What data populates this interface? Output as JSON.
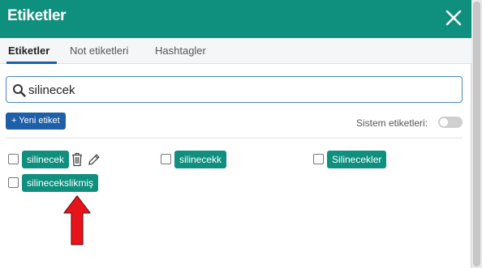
{
  "header": {
    "title": "Etiketler",
    "close_icon": "close-icon"
  },
  "tabs": [
    {
      "label": "Etiketler",
      "active": true
    },
    {
      "label": "Not etiketleri",
      "active": false
    },
    {
      "label": "Hashtagler",
      "active": false
    }
  ],
  "search": {
    "value": "silinecek",
    "icon": "search-icon"
  },
  "toolbar": {
    "new_tag_label": "+ Yeni etiket",
    "system_tags_label": "Sistem etiketleri:",
    "system_tags_enabled": false
  },
  "tags": [
    {
      "label": "silinecek",
      "checked": false
    },
    {
      "label": "silinecekk",
      "checked": false
    },
    {
      "label": "Silinecekler",
      "checked": false
    },
    {
      "label": "silinecekslikmiş",
      "checked": false
    }
  ],
  "colors": {
    "accent": "#0f8f7e",
    "primary": "#1f5fa8",
    "arrow": "#e8141c"
  }
}
